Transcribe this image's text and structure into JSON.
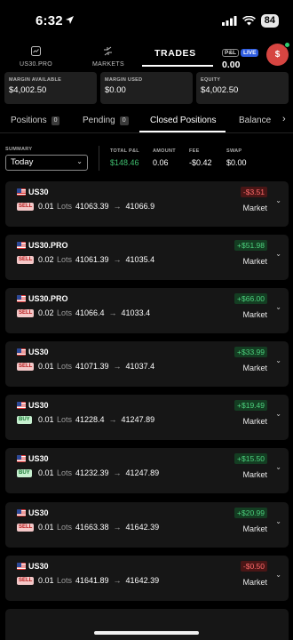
{
  "status": {
    "time": "6:32",
    "battery": "84"
  },
  "nav": {
    "item1": "US30.PRO",
    "item2": "MARKETS",
    "active": "TRADES",
    "pl_label": "P&L",
    "live_label": "LIVE",
    "pl_value": "0.00",
    "avatar": "$"
  },
  "metrics": [
    {
      "label": "MARGIN AVAILABLE",
      "value": "$4,002.50"
    },
    {
      "label": "MARGIN USED",
      "value": "$0.00"
    },
    {
      "label": "EQUITY",
      "value": "$4,002.50"
    }
  ],
  "tabs": [
    {
      "label": "Positions",
      "count": "0"
    },
    {
      "label": "Pending",
      "count": "0"
    },
    {
      "label": "Closed Positions"
    },
    {
      "label": "Balance"
    }
  ],
  "summary": {
    "label": "SUMMARY",
    "period": "Today",
    "total_pl_label": "TOTAL P&L",
    "total_pl": "$148.46",
    "amount_label": "AMOUNT",
    "amount": "0.06",
    "fee_label": "FEE",
    "fee": "-$0.42",
    "swap_label": "SWAP",
    "swap": "$0.00"
  },
  "trades": [
    {
      "symbol": "US30",
      "side": "SELL",
      "qty": "0.01",
      "lots": "Lots",
      "open": "41063.39",
      "close": "41066.9",
      "pnl": "-$3.51",
      "type": "Market"
    },
    {
      "symbol": "US30.PRO",
      "side": "SELL",
      "qty": "0.02",
      "lots": "Lots",
      "open": "41061.39",
      "close": "41035.4",
      "pnl": "+$51.98",
      "type": "Market"
    },
    {
      "symbol": "US30.PRO",
      "side": "SELL",
      "qty": "0.02",
      "lots": "Lots",
      "open": "41066.4",
      "close": "41033.4",
      "pnl": "+$66.00",
      "type": "Market"
    },
    {
      "symbol": "US30",
      "side": "SELL",
      "qty": "0.01",
      "lots": "Lots",
      "open": "41071.39",
      "close": "41037.4",
      "pnl": "+$33.99",
      "type": "Market"
    },
    {
      "symbol": "US30",
      "side": "BUY",
      "qty": "0.01",
      "lots": "Lots",
      "open": "41228.4",
      "close": "41247.89",
      "pnl": "+$19.49",
      "type": "Market"
    },
    {
      "symbol": "US30",
      "side": "BUY",
      "qty": "0.01",
      "lots": "Lots",
      "open": "41232.39",
      "close": "41247.89",
      "pnl": "+$15.50",
      "type": "Market"
    },
    {
      "symbol": "US30",
      "side": "SELL",
      "qty": "0.01",
      "lots": "Lots",
      "open": "41663.38",
      "close": "41642.39",
      "pnl": "+$20.99",
      "type": "Market"
    },
    {
      "symbol": "US30",
      "side": "SELL",
      "qty": "0.01",
      "lots": "Lots",
      "open": "41641.89",
      "close": "41642.39",
      "pnl": "-$0.50",
      "type": "Market"
    }
  ]
}
